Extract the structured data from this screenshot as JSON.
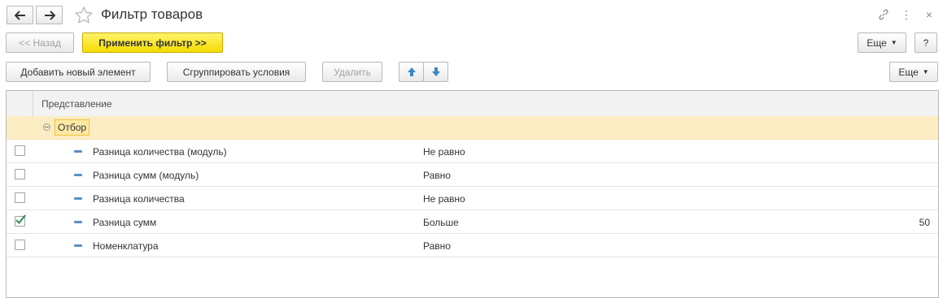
{
  "window": {
    "title": "Фильтр товаров",
    "more_icon": "⋮",
    "close_icon": "×"
  },
  "toolbar1": {
    "back_label": "<< Назад",
    "apply_label": "Применить фильтр >>",
    "more_label": "Еще",
    "help_label": "?"
  },
  "toolbar2": {
    "add_label": "Добавить новый элемент",
    "group_label": "Сгруппировать условия",
    "delete_label": "Удалить",
    "more_label": "Еще"
  },
  "table": {
    "header": "Представление",
    "group_label": "Отбор",
    "rows": [
      {
        "name": "Разница количества (модуль)",
        "comparison": "Не равно",
        "value": "",
        "checked": false
      },
      {
        "name": "Разница сумм (модуль)",
        "comparison": "Равно",
        "value": "",
        "checked": false
      },
      {
        "name": "Разница количества",
        "comparison": "Не равно",
        "value": "",
        "checked": false
      },
      {
        "name": "Разница сумм",
        "comparison": "Больше",
        "value": "50",
        "checked": true
      },
      {
        "name": "Номенклатура",
        "comparison": "Равно",
        "value": "",
        "checked": false
      }
    ]
  },
  "colors": {
    "primary_button": "#f5dc00",
    "group_row": "#fbecc2",
    "check_mark": "#2e8b57",
    "arrow_blue": "#3a86c8"
  }
}
